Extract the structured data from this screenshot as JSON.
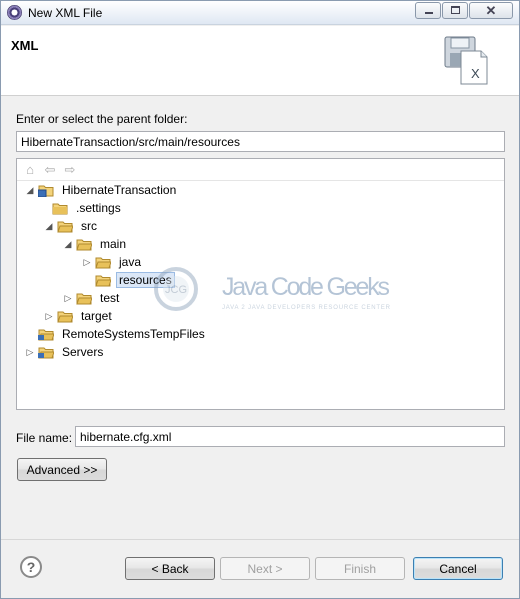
{
  "window": {
    "title": "New XML File"
  },
  "banner": {
    "title": "XML"
  },
  "parent_folder": {
    "label": "Enter or select the parent folder:",
    "value": "HibernateTransaction/src/main/resources"
  },
  "tree": {
    "nodes": [
      {
        "label": "HibernateTransaction"
      },
      {
        "label": ".settings"
      },
      {
        "label": "src"
      },
      {
        "label": "main"
      },
      {
        "label": "java"
      },
      {
        "label": "resources"
      },
      {
        "label": "test"
      },
      {
        "label": "target"
      },
      {
        "label": "RemoteSystemsTempFiles"
      },
      {
        "label": "Servers"
      }
    ],
    "selected": "resources"
  },
  "watermark": {
    "logo_text": "Java Code Geeks",
    "badge": "JCG",
    "tagline": "JAVA 2 JAVA DEVELOPERS RESOURCE CENTER"
  },
  "file_name": {
    "label": "File name:",
    "value": "hibernate.cfg.xml"
  },
  "buttons": {
    "advanced": "Advanced >>",
    "back": "< Back",
    "next": "Next >",
    "finish": "Finish",
    "cancel": "Cancel"
  },
  "colors": {
    "accent": "#3c7fb1",
    "folder": "#e8c15a",
    "project": "#3b6fb6"
  }
}
